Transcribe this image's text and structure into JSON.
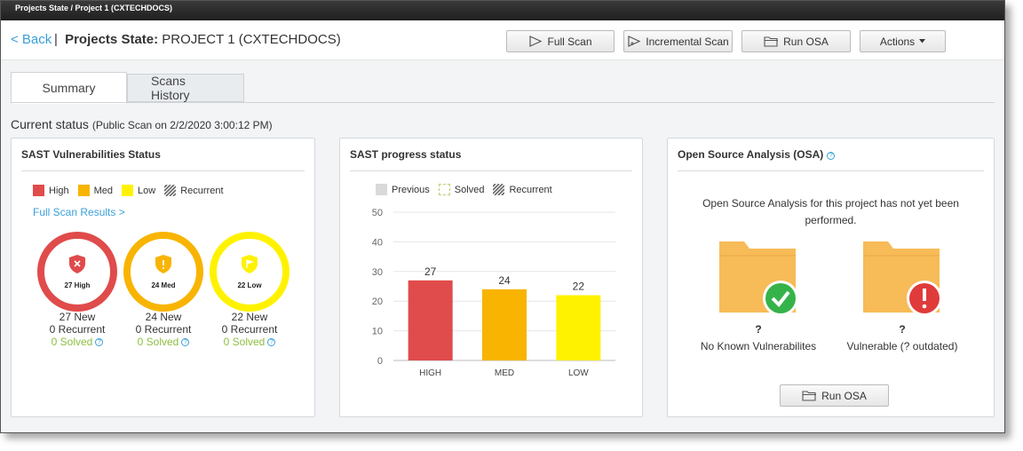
{
  "window": {
    "title": "Projects State / Project 1 (CXTECHDOCS)"
  },
  "header": {
    "back_label": "< Back",
    "separator": "|",
    "title_prefix": "Projects State:",
    "title_project": "PROJECT 1 (CXTECHDOCS)"
  },
  "toolbar": {
    "full_scan": "Full Scan",
    "incremental_scan": "Incremental Scan",
    "run_osa": "Run OSA",
    "actions": "Actions"
  },
  "tabs": [
    {
      "label": "Summary",
      "active": true
    },
    {
      "label": "Scans History",
      "active": false
    }
  ],
  "status": {
    "label": "Current status",
    "detail": "(Public Scan on 2/2/2020 3:00:12 PM)"
  },
  "sast_status": {
    "title": "SAST Vulnerabilities Status",
    "legend": [
      {
        "label": "High",
        "color": "#e04b4b"
      },
      {
        "label": "Med",
        "color": "#f8b400"
      },
      {
        "label": "Low",
        "color": "#fff200"
      },
      {
        "label": "Recurrent",
        "icon": "striped-icon"
      }
    ],
    "full_scan_link": "Full Scan Results >",
    "rings": [
      {
        "label": "27 High",
        "color": "#e04b4b",
        "new": "27 New",
        "recurrent": "0 Recurrent",
        "solved": "0 Solved"
      },
      {
        "label": "24 Med",
        "color": "#f8b400",
        "new": "24 New",
        "recurrent": "0 Recurrent",
        "solved": "0 Solved"
      },
      {
        "label": "22 Low",
        "color": "#fff200",
        "new": "22 New",
        "recurrent": "0 Recurrent",
        "solved": "0 Solved"
      }
    ],
    "help_glyph": "?"
  },
  "progress": {
    "title": "SAST progress status",
    "legend": [
      "Previous",
      "Solved",
      "Recurrent"
    ]
  },
  "chart_data": {
    "type": "bar",
    "categories": [
      "HIGH",
      "MED",
      "LOW"
    ],
    "values": [
      27,
      24,
      22
    ],
    "colors": [
      "#e04b4b",
      "#f8b400",
      "#fff200"
    ],
    "ylim": [
      0,
      50
    ],
    "yticks": [
      0,
      10,
      20,
      30,
      40,
      50
    ],
    "data_labels": true,
    "grid": true
  },
  "osa": {
    "title": "Open Source Analysis (OSA)",
    "info_glyph": "?",
    "message": "Open Source Analysis for this project has not yet been performed.",
    "no_known": {
      "value": "?",
      "label": "No Known Vulnerabilites",
      "badge_color": "#35b34a"
    },
    "vulnerable": {
      "value": "?",
      "label": "Vulnerable (? outdated)",
      "badge_color": "#e03b3b"
    },
    "run_button": "Run OSA"
  }
}
